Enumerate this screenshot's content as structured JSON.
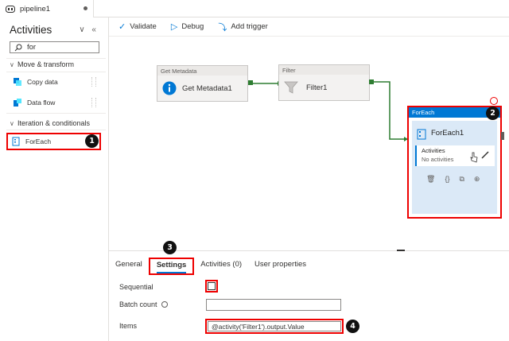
{
  "tab": {
    "title": "pipeline1"
  },
  "activities_panel": {
    "title": "Activities",
    "collapse_icons": "∨ «",
    "search_value": "for",
    "sections": [
      {
        "label": "Move & transform",
        "items": [
          "Copy data",
          "Data flow"
        ]
      },
      {
        "label": "Iteration & conditionals",
        "items": [
          "ForEach"
        ]
      }
    ]
  },
  "toolbar": {
    "validate": "Validate",
    "debug": "Debug",
    "add_trigger": "Add trigger"
  },
  "canvas": {
    "get_metadata": {
      "header": "Get Metadata",
      "name": "Get Metadata1"
    },
    "filter": {
      "header": "Filter",
      "name": "Filter1"
    },
    "foreach": {
      "header": "ForEach",
      "name": "ForEach1",
      "activities_label": "Activities",
      "activities_value": "No activities"
    }
  },
  "bottom_panel": {
    "tabs": [
      "General",
      "Settings",
      "Activities (0)",
      "User properties"
    ],
    "active_tab": "Settings",
    "sequential_label": "Sequential",
    "batch_count_label": "Batch count",
    "items_label": "Items",
    "items_value": "@activity('Filter1').output.Value"
  },
  "badges": [
    "1",
    "2",
    "3",
    "4"
  ],
  "colors": {
    "accent": "#0078d4",
    "highlight": "#e00000",
    "connector": "#2e7d32"
  }
}
